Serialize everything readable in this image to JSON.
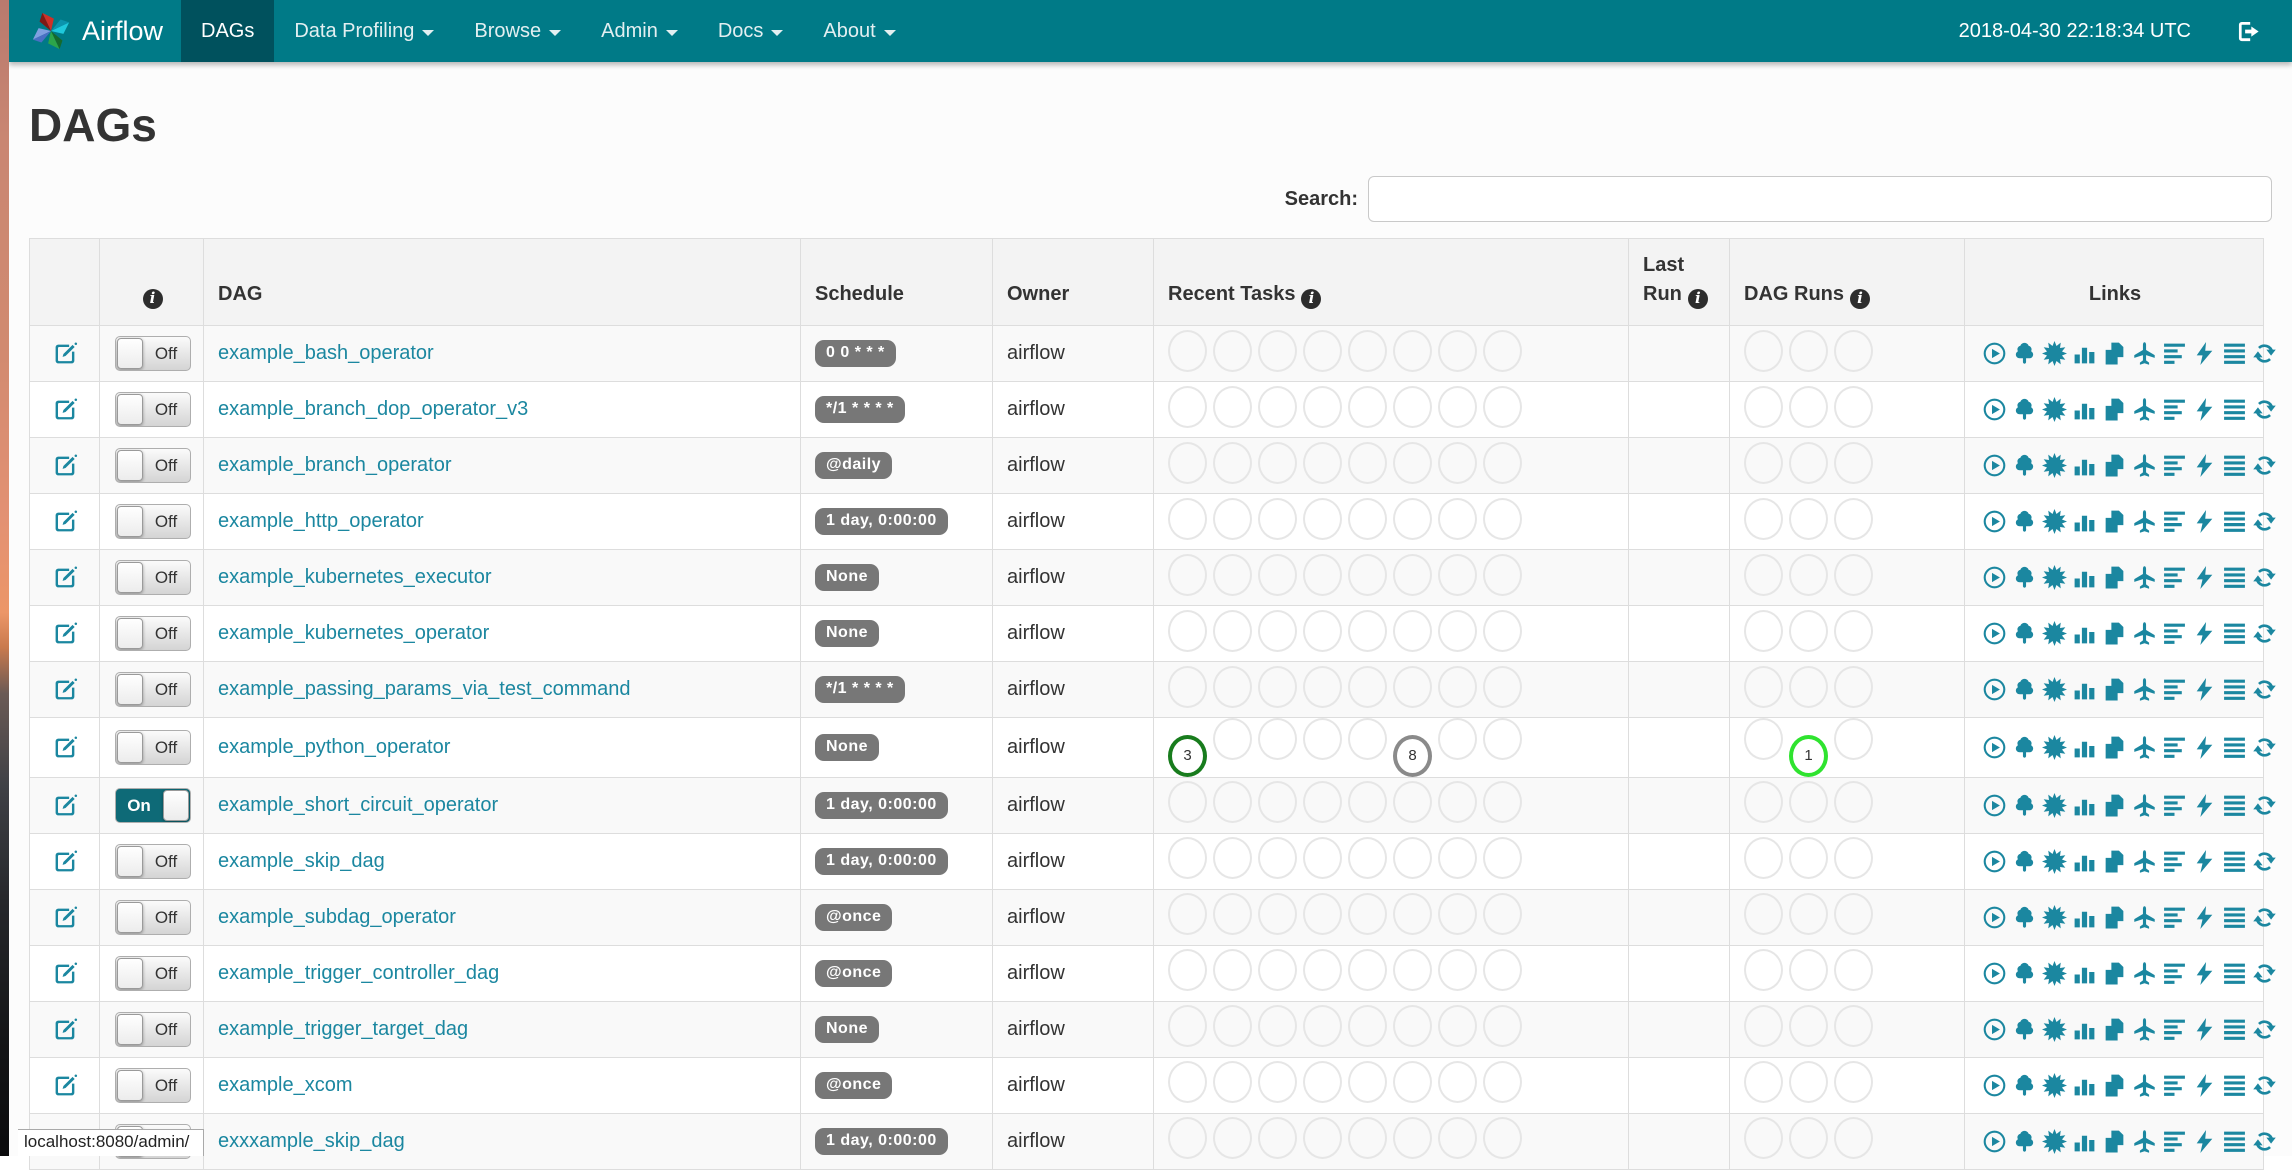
{
  "browser": {
    "status_bar": "localhost:8080/admin/"
  },
  "navbar": {
    "brand": "Airflow",
    "items": [
      {
        "label": "DAGs",
        "active": true,
        "dropdown": false
      },
      {
        "label": "Data Profiling",
        "active": false,
        "dropdown": true
      },
      {
        "label": "Browse",
        "active": false,
        "dropdown": true
      },
      {
        "label": "Admin",
        "active": false,
        "dropdown": true
      },
      {
        "label": "Docs",
        "active": false,
        "dropdown": true
      },
      {
        "label": "About",
        "active": false,
        "dropdown": true
      }
    ],
    "clock": "2018-04-30 22:18:34 UTC"
  },
  "page": {
    "title": "DAGs",
    "search_label": "Search:",
    "search_value": ""
  },
  "colors": {
    "navbar_bg": "#007a87",
    "navbar_active_bg": "#00515d",
    "link_teal": "#1b87a0",
    "badge_gray": "#777777",
    "toggle_on_teal": "#0e6a77"
  },
  "table": {
    "headers": {
      "edit": "",
      "dag": "DAG",
      "schedule": "Schedule",
      "owner": "Owner",
      "recent_tasks": "Recent Tasks",
      "last_run": "Last Run",
      "dag_runs": "DAG Runs",
      "links": "Links"
    },
    "toggle_labels": {
      "on": "On",
      "off": "Off"
    },
    "recent_slots": 8,
    "dag_run_slots": 3,
    "state_colors": {
      "success": "#187c1d",
      "queued": "#8a8a8a",
      "running": "#2fe32f"
    },
    "links": [
      {
        "name": "trigger-dag",
        "icon": "play-circle"
      },
      {
        "name": "tree-view",
        "icon": "tree"
      },
      {
        "name": "graph-view",
        "icon": "sunburst"
      },
      {
        "name": "task-duration",
        "icon": "bar-chart"
      },
      {
        "name": "task-tries",
        "icon": "duplicate"
      },
      {
        "name": "landing-times",
        "icon": "plane"
      },
      {
        "name": "gantt-view",
        "icon": "align-left"
      },
      {
        "name": "code-view",
        "icon": "bolt"
      },
      {
        "name": "logs",
        "icon": "align-justify"
      },
      {
        "name": "refresh",
        "icon": "refresh"
      }
    ],
    "rows": [
      {
        "name": "example_bash_operator",
        "schedule": "0 0 * * *",
        "owner": "airflow",
        "on": false,
        "last_run": "",
        "recent": [],
        "runs": []
      },
      {
        "name": "example_branch_dop_operator_v3",
        "schedule": "*/1 * * * *",
        "owner": "airflow",
        "on": false,
        "last_run": "",
        "recent": [],
        "runs": []
      },
      {
        "name": "example_branch_operator",
        "schedule": "@daily",
        "owner": "airflow",
        "on": false,
        "last_run": "",
        "recent": [],
        "runs": []
      },
      {
        "name": "example_http_operator",
        "schedule": "1 day, 0:00:00",
        "owner": "airflow",
        "on": false,
        "last_run": "",
        "recent": [],
        "runs": []
      },
      {
        "name": "example_kubernetes_executor",
        "schedule": "None",
        "owner": "airflow",
        "on": false,
        "last_run": "",
        "recent": [],
        "runs": []
      },
      {
        "name": "example_kubernetes_operator",
        "schedule": "None",
        "owner": "airflow",
        "on": false,
        "last_run": "",
        "recent": [],
        "runs": []
      },
      {
        "name": "example_passing_params_via_test_command",
        "schedule": "*/1 * * * *",
        "owner": "airflow",
        "on": false,
        "last_run": "",
        "recent": [],
        "runs": []
      },
      {
        "name": "example_python_operator",
        "schedule": "None",
        "owner": "airflow",
        "on": false,
        "last_run": "",
        "recent": [
          {
            "slot": 0,
            "count": "3",
            "state": "success"
          },
          {
            "slot": 5,
            "count": "8",
            "state": "queued"
          }
        ],
        "runs": [
          {
            "slot": 1,
            "count": "1",
            "state": "running"
          }
        ]
      },
      {
        "name": "example_short_circuit_operator",
        "schedule": "1 day, 0:00:00",
        "owner": "airflow",
        "on": true,
        "last_run": "",
        "recent": [],
        "runs": []
      },
      {
        "name": "example_skip_dag",
        "schedule": "1 day, 0:00:00",
        "owner": "airflow",
        "on": false,
        "last_run": "",
        "recent": [],
        "runs": []
      },
      {
        "name": "example_subdag_operator",
        "schedule": "@once",
        "owner": "airflow",
        "on": false,
        "last_run": "",
        "recent": [],
        "runs": []
      },
      {
        "name": "example_trigger_controller_dag",
        "schedule": "@once",
        "owner": "airflow",
        "on": false,
        "last_run": "",
        "recent": [],
        "runs": []
      },
      {
        "name": "example_trigger_target_dag",
        "schedule": "None",
        "owner": "airflow",
        "on": false,
        "last_run": "",
        "recent": [],
        "runs": []
      },
      {
        "name": "example_xcom",
        "schedule": "@once",
        "owner": "airflow",
        "on": false,
        "last_run": "",
        "recent": [],
        "runs": []
      },
      {
        "name": "exxxample_skip_dag",
        "schedule": "1 day, 0:00:00",
        "owner": "airflow",
        "on": false,
        "last_run": "",
        "recent": [],
        "runs": []
      }
    ]
  }
}
